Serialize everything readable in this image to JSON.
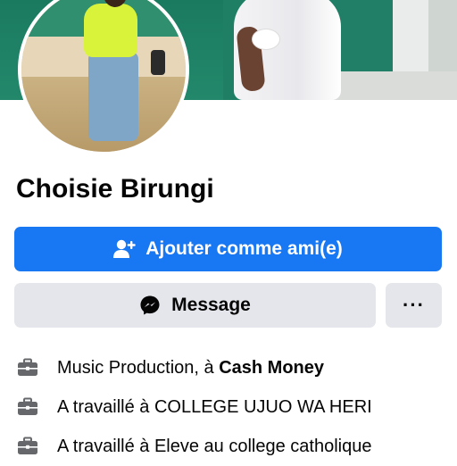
{
  "profile": {
    "name": "Choisie Birungi"
  },
  "actions": {
    "add_friend_label": "Ajouter comme ami(e)",
    "message_label": "Message",
    "more_label": "···"
  },
  "info": [
    {
      "icon": "briefcase-icon",
      "prefix": "Music Production, à ",
      "emphasis": "Cash Money"
    },
    {
      "icon": "briefcase-icon",
      "prefix": "A travaillé à COLLEGE UJUO WA HERI",
      "emphasis": ""
    },
    {
      "icon": "briefcase-icon",
      "prefix": "A travaillé à Eleve au college catholique",
      "emphasis": ""
    }
  ],
  "colors": {
    "primary": "#1877f2",
    "secondary_bg": "#e4e6eb",
    "text": "#050505",
    "icon_gray": "#65676b"
  }
}
